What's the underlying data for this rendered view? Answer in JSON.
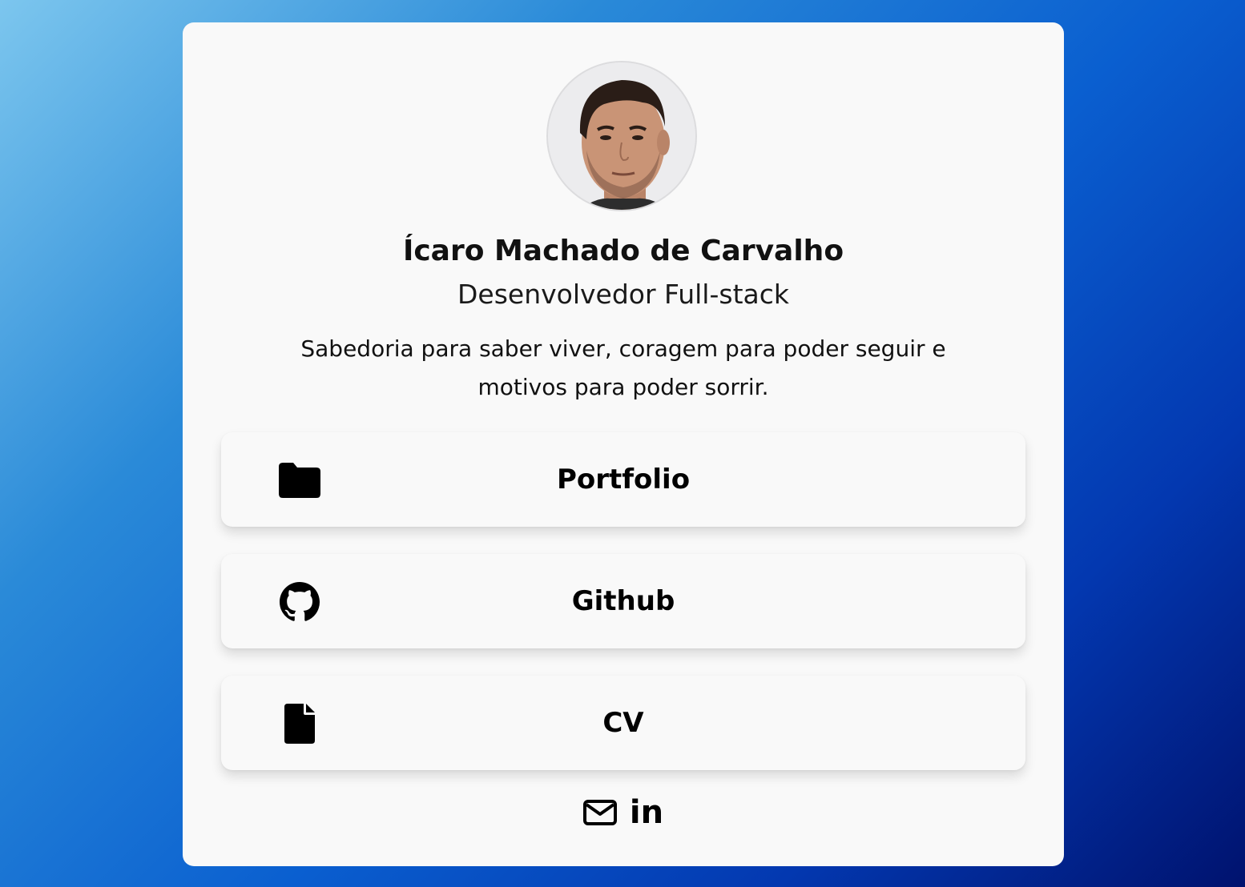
{
  "profile": {
    "name": "Ícaro Machado de Carvalho",
    "role": "Desenvolvedor Full-stack",
    "bio": "Sabedoria para saber viver, coragem para poder seguir e motivos para poder sorrir."
  },
  "links": [
    {
      "label": "Portfolio",
      "icon": "folder-icon"
    },
    {
      "label": "Github",
      "icon": "github-icon"
    },
    {
      "label": "CV",
      "icon": "file-icon"
    }
  ],
  "socials": [
    {
      "icon": "envelope-icon"
    },
    {
      "icon": "linkedin-icon",
      "text": "in"
    }
  ],
  "colors": {
    "card_background": "#f9f9f9",
    "text": "#111111",
    "gradient_start": "#7cc6ee",
    "gradient_end": "#00126e"
  }
}
